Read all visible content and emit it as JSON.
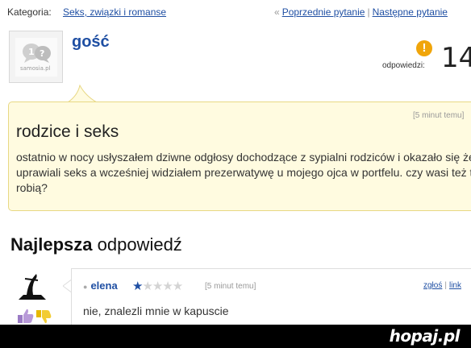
{
  "breadcrumb": {
    "label": "Kategoria:",
    "category": "Seks, związki i romanse"
  },
  "navigation": {
    "chevron": "«",
    "previous": "Poprzednie pytanie",
    "separator": "|",
    "next": "Następne pytanie"
  },
  "asker": {
    "avatar_text": "samosia.pl",
    "name": "gość"
  },
  "answers": {
    "icon": "question-mark-icon",
    "label": "odpowiedzi:",
    "count": "14"
  },
  "question": {
    "time_ago": "[5 minut temu]",
    "title": "rodzice i seks",
    "body": "ostatnio w nocy usłyszałem dziwne odgłosy dochodzące z sypialni rodziców i okazało się że uprawiali seks a wcześniej widziałem prezerwatywę u mojego ojca w portfelu. czy wasi też to robią?"
  },
  "best_answer": {
    "heading_bold": "Najlepsza",
    "heading_rest": " odpowiedź",
    "user": "elena",
    "rating": 1,
    "rating_max": 5,
    "time_ago": "[5 minut temu]",
    "report_link": "zgłoś",
    "link_link": "link",
    "body": "nie, znalezli mnie w kapuscie"
  },
  "watermark": {
    "brand": "hopaj.pl"
  },
  "colors": {
    "link": "#1f4fa3",
    "question_bg": "#fffbe0",
    "question_border": "#e8d884",
    "answers_icon": "#f0a50a"
  }
}
